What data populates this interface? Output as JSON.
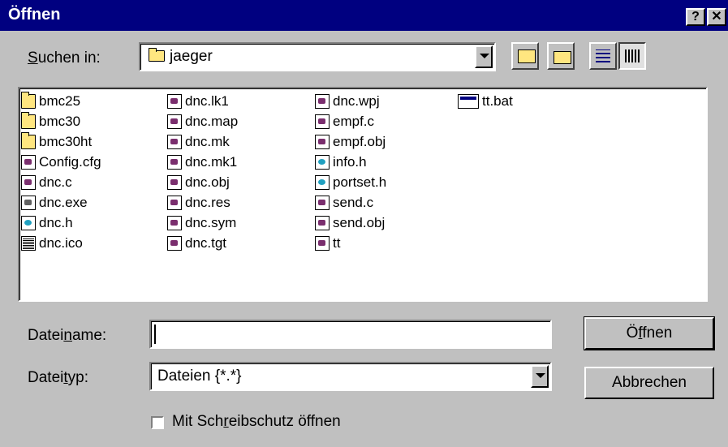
{
  "window": {
    "title": "Öffnen",
    "help_label": "?",
    "close_label": "✕"
  },
  "lookin": {
    "label_pre": "",
    "label_u": "S",
    "label_post": "uchen in:",
    "value": "jaeger"
  },
  "toolbar": [
    {
      "name": "up-one-level-icon"
    },
    {
      "name": "new-folder-icon"
    },
    {
      "name": "list-view-icon"
    },
    {
      "name": "details-view-icon"
    }
  ],
  "files": [
    {
      "name": "bmc25",
      "type": "folder"
    },
    {
      "name": "bmc30",
      "type": "folder"
    },
    {
      "name": "bmc30ht",
      "type": "folder"
    },
    {
      "name": "Config.cfg",
      "type": "doc"
    },
    {
      "name": "dnc.c",
      "type": "doc"
    },
    {
      "name": "dnc.exe",
      "type": "exe"
    },
    {
      "name": "dnc.h",
      "type": "h"
    },
    {
      "name": "dnc.ico",
      "type": "ico"
    },
    {
      "name": "dnc.lk1",
      "type": "doc"
    },
    {
      "name": "dnc.map",
      "type": "doc"
    },
    {
      "name": "dnc.mk",
      "type": "doc"
    },
    {
      "name": "dnc.mk1",
      "type": "doc"
    },
    {
      "name": "dnc.obj",
      "type": "doc"
    },
    {
      "name": "dnc.res",
      "type": "doc"
    },
    {
      "name": "dnc.sym",
      "type": "doc"
    },
    {
      "name": "dnc.tgt",
      "type": "doc"
    },
    {
      "name": "dnc.wpj",
      "type": "doc"
    },
    {
      "name": "empf.c",
      "type": "doc"
    },
    {
      "name": "empf.obj",
      "type": "doc"
    },
    {
      "name": "info.h",
      "type": "h"
    },
    {
      "name": "portset.h",
      "type": "h"
    },
    {
      "name": "send.c",
      "type": "doc"
    },
    {
      "name": "send.obj",
      "type": "doc"
    },
    {
      "name": "tt",
      "type": "doc"
    },
    {
      "name": "tt.bat",
      "type": "bat"
    }
  ],
  "filename": {
    "label_pre": "Datei",
    "label_u": "n",
    "label_post": "ame:",
    "value": ""
  },
  "filetype": {
    "label_pre": "Datei",
    "label_u": "t",
    "label_post": "yp:",
    "value": "Dateien {*.*}"
  },
  "buttons": {
    "open_pre": "Ö",
    "open_u": "f",
    "open_post": "fnen",
    "cancel": "Abbrechen"
  },
  "readonly": {
    "label_pre": "Mit Sch",
    "label_u": "r",
    "label_post": "eibschutz öffnen",
    "checked": false
  }
}
